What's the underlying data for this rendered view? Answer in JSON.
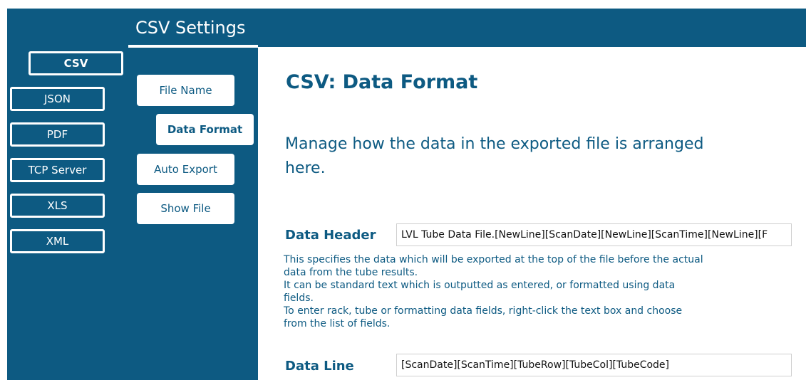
{
  "window": {
    "title": "CSV Settings"
  },
  "formats": [
    {
      "label": "CSV",
      "active": true
    },
    {
      "label": "JSON"
    },
    {
      "label": "PDF"
    },
    {
      "label": "TCP Server"
    },
    {
      "label": "XLS"
    },
    {
      "label": "XML"
    }
  ],
  "subnav": [
    {
      "label": "File Name"
    },
    {
      "label": "Data Format",
      "active": true
    },
    {
      "label": "Auto Export"
    },
    {
      "label": "Show File"
    }
  ],
  "main": {
    "heading": "CSV: Data Format",
    "description": "Manage how the data in the exported file is arranged here.",
    "data_header": {
      "label": "Data Header",
      "value": "LVL Tube Data File.[NewLine][ScanDate][NewLine][ScanTime][NewLine][F"
    },
    "help_lines": [
      "This specifies the data which will be exported at the top of the file before the actual",
      "data from the tube results.",
      "It can be standard text which is outputted as entered, or formatted using data",
      "fields.",
      "To enter rack, tube or formatting data fields, right-click the text box and choose",
      "from the list of fields."
    ],
    "data_line": {
      "label": "Data Line",
      "value": "[ScanDate][ScanTime][TubeRow][TubeCol][TubeCode]"
    }
  },
  "colors": {
    "primary": "#0d5a82",
    "background": "#ffffff"
  }
}
